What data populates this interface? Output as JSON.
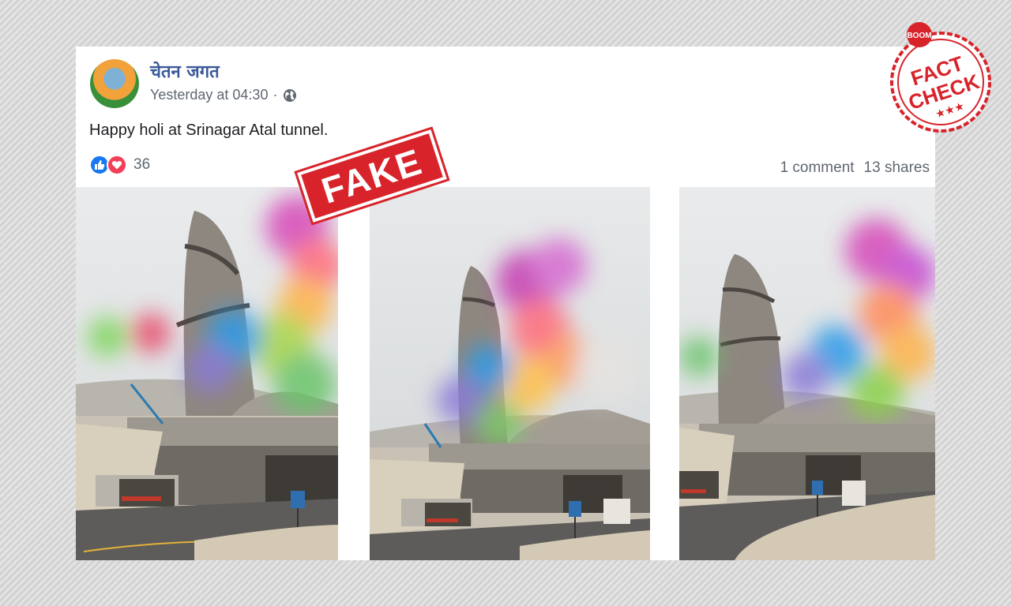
{
  "post": {
    "author": "चेतन जगत",
    "time": "Yesterday at 04:30",
    "separator": "·",
    "text": "Happy holi at Srinagar Atal tunnel.",
    "reaction_count": "36",
    "comments": "1 comment",
    "shares": "13 shares"
  },
  "stamp": {
    "text": "FAKE"
  },
  "badge": {
    "top": "BOOM",
    "line1": "FACT",
    "line2": "CHECK"
  },
  "icons": {
    "privacy": "globe-icon",
    "like": "like-reaction-icon",
    "love": "love-reaction-icon"
  },
  "colors": {
    "author": "#3b5998",
    "meta": "#606770",
    "stamp": "#d8232a",
    "like": "#1877f2",
    "love": "#f33e58"
  }
}
